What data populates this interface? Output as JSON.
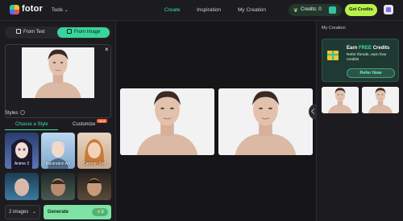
{
  "header": {
    "brand": "fotor",
    "tools_label": "Tools",
    "nav": [
      "Create",
      "Inspiration",
      "My Creation"
    ],
    "credits_label": "Credits:",
    "credits_value": "0",
    "get_credits": "Get Credits",
    "accent": "#3fe0a0"
  },
  "left": {
    "tab_text": "From Text",
    "tab_image": "From Image",
    "close": "×",
    "styles_title": "Styles",
    "subtabs": [
      "Choose a Style",
      "Customize"
    ],
    "new_badge": "NEW",
    "styles": [
      "Anime 2",
      "Illustration Art",
      "Cartoon Self",
      "",
      "",
      ""
    ],
    "image_count": "2 images",
    "generate": "Generate",
    "generate_cost": "3"
  },
  "right": {
    "title": "My Creation",
    "refer_heading_1": "Earn ",
    "refer_heading_hl": "FREE",
    "refer_heading_2": " Credits",
    "refer_text": "Refer friends, earn free credits!",
    "refer_button": "Refer Now"
  }
}
